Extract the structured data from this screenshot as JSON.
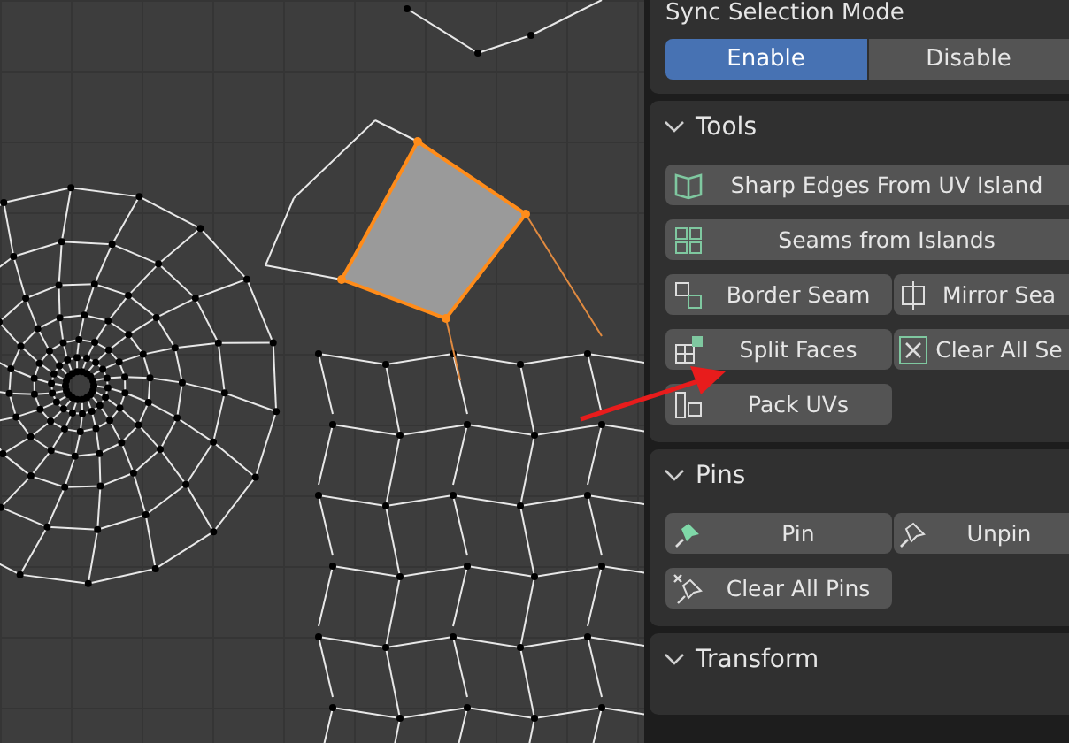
{
  "sync_selection": {
    "label": "Sync Selection Mode",
    "options": [
      {
        "label": "Enable",
        "selected": true
      },
      {
        "label": "Disable",
        "selected": false
      }
    ]
  },
  "panels": [
    {
      "title": "Tools",
      "expanded": true,
      "rows": [
        [
          {
            "label": "Sharp Edges From UV Island"
          }
        ],
        [
          {
            "label": "Seams from Islands"
          }
        ],
        [
          {
            "label": "Border Seam"
          },
          {
            "label": "Mirror Sea"
          }
        ],
        [
          {
            "label": "Split Faces"
          },
          {
            "label": "Clear All Se"
          }
        ],
        [
          {
            "label": "Pack UVs"
          }
        ]
      ]
    },
    {
      "title": "Pins",
      "expanded": true,
      "rows": [
        [
          {
            "label": "Pin"
          },
          {
            "label": "Unpin"
          }
        ],
        [
          {
            "label": "Clear All Pins"
          }
        ]
      ]
    },
    {
      "title": "Transform",
      "expanded": true
    }
  ]
}
